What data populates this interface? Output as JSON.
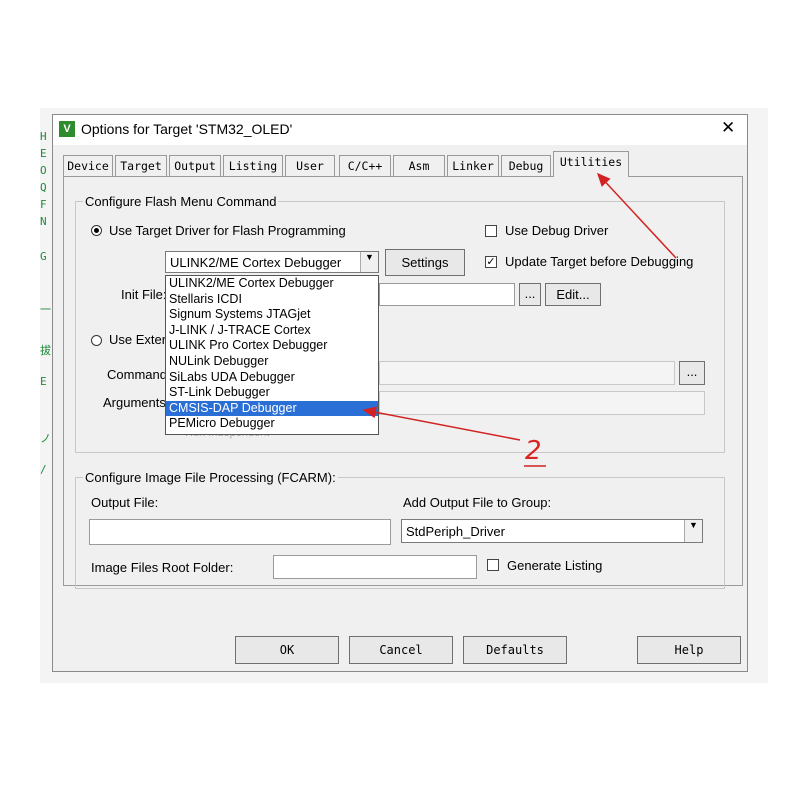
{
  "background_chars": [
    "H",
    "E",
    "O",
    "Q",
    "F",
    "N",
    "G",
    "一",
    "拔",
    "E",
    "ノ",
    "/"
  ],
  "window": {
    "title": "Options for Target 'STM32_OLED'",
    "close_glyph": "✕",
    "logo": "V"
  },
  "tabs": [
    {
      "label": "Device",
      "active": false
    },
    {
      "label": "Target",
      "active": false
    },
    {
      "label": "Output",
      "active": false
    },
    {
      "label": "Listing",
      "active": false
    },
    {
      "label": "User",
      "active": false
    },
    {
      "label": "C/C++",
      "active": false
    },
    {
      "label": "Asm",
      "active": false
    },
    {
      "label": "Linker",
      "active": false
    },
    {
      "label": "Debug",
      "active": false
    },
    {
      "label": "Utilities",
      "active": true
    }
  ],
  "flash_group": {
    "label": "Configure Flash Menu Command",
    "use_target_driver": "Use Target Driver for Flash Programming",
    "use_debug_driver": "Use Debug Driver",
    "update_target": "Update Target before Debugging",
    "selected_driver": "ULINK2/ME Cortex Debugger",
    "settings": "Settings",
    "init_file": "Init File:",
    "browse": "...",
    "edit": "Edit...",
    "use_external": "Use Extern",
    "command": "Command:",
    "arguments": "Arguments:",
    "run_independent": "Run Independent",
    "command_browse": "..."
  },
  "driver_options": [
    "ULINK2/ME Cortex Debugger",
    "Stellaris ICDI",
    "Signum Systems JTAGjet",
    "J-LINK / J-TRACE Cortex",
    "ULINK Pro Cortex Debugger",
    "NULink Debugger",
    "SiLabs UDA Debugger",
    "ST-Link Debugger",
    "CMSIS-DAP Debugger",
    "PEMicro Debugger"
  ],
  "highlighted_option": "CMSIS-DAP Debugger",
  "image_group": {
    "label": "Configure Image File Processing (FCARM):",
    "output_file": "Output File:",
    "add_output": "Add Output File  to Group:",
    "group_value": "StdPeriph_Driver",
    "root_folder": "Image Files Root Folder:",
    "generate_listing": "Generate Listing"
  },
  "buttons": {
    "ok": "OK",
    "cancel": "Cancel",
    "defaults": "Defaults",
    "help": "Help"
  },
  "annotation": {
    "number": "2",
    "color": "#d22222"
  },
  "colors": {
    "highlight": "#2a6fd6",
    "accent_green": "#2e8b2e"
  }
}
